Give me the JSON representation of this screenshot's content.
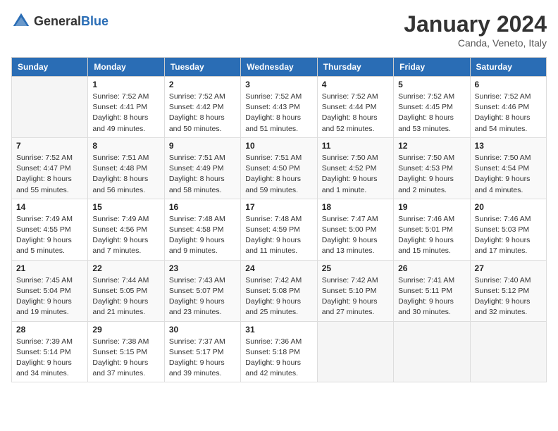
{
  "header": {
    "logo_general": "General",
    "logo_blue": "Blue",
    "month_year": "January 2024",
    "location": "Canda, Veneto, Italy"
  },
  "weekdays": [
    "Sunday",
    "Monday",
    "Tuesday",
    "Wednesday",
    "Thursday",
    "Friday",
    "Saturday"
  ],
  "weeks": [
    [
      {
        "day": "",
        "info": ""
      },
      {
        "day": "1",
        "info": "Sunrise: 7:52 AM\nSunset: 4:41 PM\nDaylight: 8 hours\nand 49 minutes."
      },
      {
        "day": "2",
        "info": "Sunrise: 7:52 AM\nSunset: 4:42 PM\nDaylight: 8 hours\nand 50 minutes."
      },
      {
        "day": "3",
        "info": "Sunrise: 7:52 AM\nSunset: 4:43 PM\nDaylight: 8 hours\nand 51 minutes."
      },
      {
        "day": "4",
        "info": "Sunrise: 7:52 AM\nSunset: 4:44 PM\nDaylight: 8 hours\nand 52 minutes."
      },
      {
        "day": "5",
        "info": "Sunrise: 7:52 AM\nSunset: 4:45 PM\nDaylight: 8 hours\nand 53 minutes."
      },
      {
        "day": "6",
        "info": "Sunrise: 7:52 AM\nSunset: 4:46 PM\nDaylight: 8 hours\nand 54 minutes."
      }
    ],
    [
      {
        "day": "7",
        "info": "Sunrise: 7:52 AM\nSunset: 4:47 PM\nDaylight: 8 hours\nand 55 minutes."
      },
      {
        "day": "8",
        "info": "Sunrise: 7:51 AM\nSunset: 4:48 PM\nDaylight: 8 hours\nand 56 minutes."
      },
      {
        "day": "9",
        "info": "Sunrise: 7:51 AM\nSunset: 4:49 PM\nDaylight: 8 hours\nand 58 minutes."
      },
      {
        "day": "10",
        "info": "Sunrise: 7:51 AM\nSunset: 4:50 PM\nDaylight: 8 hours\nand 59 minutes."
      },
      {
        "day": "11",
        "info": "Sunrise: 7:50 AM\nSunset: 4:52 PM\nDaylight: 9 hours\nand 1 minute."
      },
      {
        "day": "12",
        "info": "Sunrise: 7:50 AM\nSunset: 4:53 PM\nDaylight: 9 hours\nand 2 minutes."
      },
      {
        "day": "13",
        "info": "Sunrise: 7:50 AM\nSunset: 4:54 PM\nDaylight: 9 hours\nand 4 minutes."
      }
    ],
    [
      {
        "day": "14",
        "info": "Sunrise: 7:49 AM\nSunset: 4:55 PM\nDaylight: 9 hours\nand 5 minutes."
      },
      {
        "day": "15",
        "info": "Sunrise: 7:49 AM\nSunset: 4:56 PM\nDaylight: 9 hours\nand 7 minutes."
      },
      {
        "day": "16",
        "info": "Sunrise: 7:48 AM\nSunset: 4:58 PM\nDaylight: 9 hours\nand 9 minutes."
      },
      {
        "day": "17",
        "info": "Sunrise: 7:48 AM\nSunset: 4:59 PM\nDaylight: 9 hours\nand 11 minutes."
      },
      {
        "day": "18",
        "info": "Sunrise: 7:47 AM\nSunset: 5:00 PM\nDaylight: 9 hours\nand 13 minutes."
      },
      {
        "day": "19",
        "info": "Sunrise: 7:46 AM\nSunset: 5:01 PM\nDaylight: 9 hours\nand 15 minutes."
      },
      {
        "day": "20",
        "info": "Sunrise: 7:46 AM\nSunset: 5:03 PM\nDaylight: 9 hours\nand 17 minutes."
      }
    ],
    [
      {
        "day": "21",
        "info": "Sunrise: 7:45 AM\nSunset: 5:04 PM\nDaylight: 9 hours\nand 19 minutes."
      },
      {
        "day": "22",
        "info": "Sunrise: 7:44 AM\nSunset: 5:05 PM\nDaylight: 9 hours\nand 21 minutes."
      },
      {
        "day": "23",
        "info": "Sunrise: 7:43 AM\nSunset: 5:07 PM\nDaylight: 9 hours\nand 23 minutes."
      },
      {
        "day": "24",
        "info": "Sunrise: 7:42 AM\nSunset: 5:08 PM\nDaylight: 9 hours\nand 25 minutes."
      },
      {
        "day": "25",
        "info": "Sunrise: 7:42 AM\nSunset: 5:10 PM\nDaylight: 9 hours\nand 27 minutes."
      },
      {
        "day": "26",
        "info": "Sunrise: 7:41 AM\nSunset: 5:11 PM\nDaylight: 9 hours\nand 30 minutes."
      },
      {
        "day": "27",
        "info": "Sunrise: 7:40 AM\nSunset: 5:12 PM\nDaylight: 9 hours\nand 32 minutes."
      }
    ],
    [
      {
        "day": "28",
        "info": "Sunrise: 7:39 AM\nSunset: 5:14 PM\nDaylight: 9 hours\nand 34 minutes."
      },
      {
        "day": "29",
        "info": "Sunrise: 7:38 AM\nSunset: 5:15 PM\nDaylight: 9 hours\nand 37 minutes."
      },
      {
        "day": "30",
        "info": "Sunrise: 7:37 AM\nSunset: 5:17 PM\nDaylight: 9 hours\nand 39 minutes."
      },
      {
        "day": "31",
        "info": "Sunrise: 7:36 AM\nSunset: 5:18 PM\nDaylight: 9 hours\nand 42 minutes."
      },
      {
        "day": "",
        "info": ""
      },
      {
        "day": "",
        "info": ""
      },
      {
        "day": "",
        "info": ""
      }
    ]
  ]
}
